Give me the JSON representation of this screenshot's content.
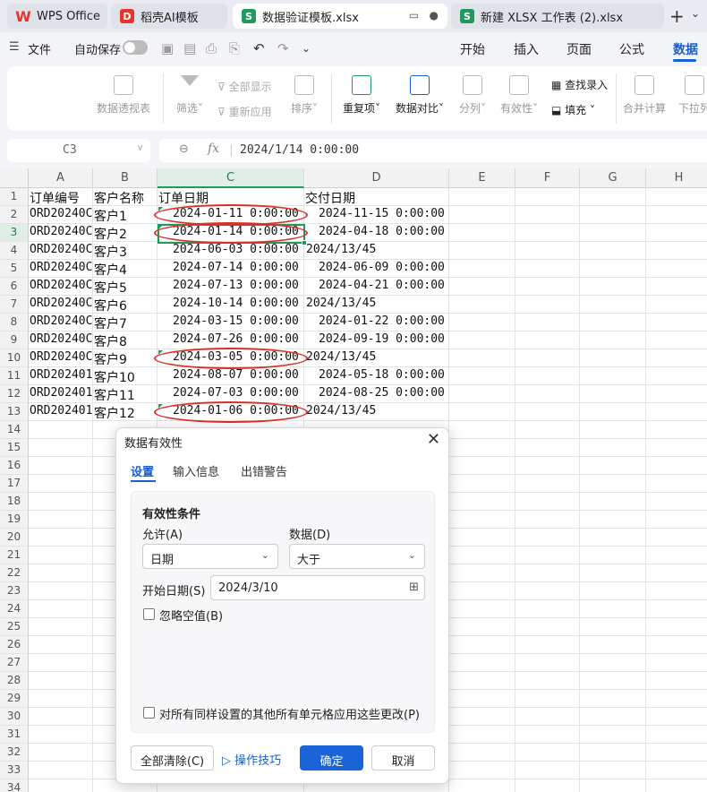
{
  "tabs": [
    {
      "label": "WPS Office",
      "icon": "wps-logo-icon"
    },
    {
      "label": "稻壳AI模板",
      "icon": "docer-icon"
    },
    {
      "label": "数据验证模板.xlsx",
      "icon": "sheet-icon"
    },
    {
      "label": "新建 XLSX 工作表 (2).xlsx",
      "icon": "sheet-icon"
    }
  ],
  "menu": {
    "file": "文件",
    "autosave": "自动保存",
    "nav": [
      "开始",
      "插入",
      "页面",
      "公式",
      "数据"
    ],
    "selected_nav": "数据"
  },
  "ribbon": {
    "pivot": "数据透视表",
    "filter": "筛选",
    "show_all": "全部显示",
    "reapply": "重新应用",
    "sort": "排序",
    "duplicates": "重复项",
    "compare": "数据对比",
    "split": "分列",
    "validity": "有效性",
    "lookup_entry": "查找录入",
    "fill": "填充",
    "consolidate": "合并计算",
    "dropdown": "下拉列"
  },
  "formula_bar": {
    "name_box": "C3",
    "fx": "fx",
    "value": "2024/1/14 0:00:00"
  },
  "sheet": {
    "columns": [
      "A",
      "B",
      "C",
      "D",
      "E",
      "F",
      "G",
      "H"
    ],
    "selected_column": "C",
    "selected_row": "3",
    "row_numbers": [
      "1",
      "2",
      "3",
      "4",
      "5",
      "6",
      "7",
      "8",
      "9",
      "10",
      "11",
      "12",
      "13",
      "14",
      "15",
      "16",
      "17",
      "18",
      "19",
      "20",
      "21",
      "22",
      "23",
      "24",
      "25",
      "26",
      "27",
      "28",
      "29",
      "30",
      "31",
      "32",
      "33",
      "34"
    ],
    "headers": [
      "订单编号",
      "客户名称",
      "订单日期",
      "交付日期"
    ],
    "rows": [
      [
        "ORD20240C",
        "客户1",
        "2024-01-11 0:00:00",
        "2024-11-15 0:00:00"
      ],
      [
        "ORD20240C",
        "客户2",
        "2024-01-14 0:00:00",
        "2024-04-18 0:00:00"
      ],
      [
        "ORD20240C",
        "客户3",
        "2024-06-03 0:00:00",
        "2024/13/45"
      ],
      [
        "ORD20240C",
        "客户4",
        "2024-07-14 0:00:00",
        "2024-06-09 0:00:00"
      ],
      [
        "ORD20240C",
        "客户5",
        "2024-07-13 0:00:00",
        "2024-04-21 0:00:00"
      ],
      [
        "ORD20240C",
        "客户6",
        "2024-10-14 0:00:00",
        "2024/13/45"
      ],
      [
        "ORD20240C",
        "客户7",
        "2024-03-15 0:00:00",
        "2024-01-22 0:00:00"
      ],
      [
        "ORD20240C",
        "客户8",
        "2024-07-26 0:00:00",
        "2024-09-19 0:00:00"
      ],
      [
        "ORD20240C",
        "客户9",
        "2024-03-05 0:00:00",
        "2024/13/45"
      ],
      [
        "ORD202401",
        "客户10",
        "2024-08-07 0:00:00",
        "2024-05-18 0:00:00"
      ],
      [
        "ORD202401",
        "客户11",
        "2024-07-03 0:00:00",
        "2024-08-25 0:00:00"
      ],
      [
        "ORD202401",
        "客户12",
        "2024-01-06 0:00:00",
        "2024/13/45"
      ]
    ],
    "circled_rows": [
      2,
      3,
      10,
      13
    ]
  },
  "dialog": {
    "title": "数据有效性",
    "tabs": [
      "设置",
      "输入信息",
      "出错警告"
    ],
    "selected_tab": "设置",
    "section_title": "有效性条件",
    "allow_label": "允许(A)",
    "allow_value": "日期",
    "data_label": "数据(D)",
    "data_value": "大于",
    "start_label": "开始日期(S)",
    "start_value": "2024/3/10",
    "ignore_blank": "忽略空值(B)",
    "ignore_blank_checked": false,
    "apply_all": "对所有同样设置的其他所有单元格应用这些更改(P)",
    "apply_all_checked": false,
    "buttons": {
      "clear": "全部清除(C)",
      "tips": "操作技巧",
      "ok": "确定",
      "cancel": "取消"
    }
  },
  "colors": {
    "accent": "#1a5fd0",
    "sheet_green": "#1f9a5c",
    "circle_red": "#d9302a"
  }
}
